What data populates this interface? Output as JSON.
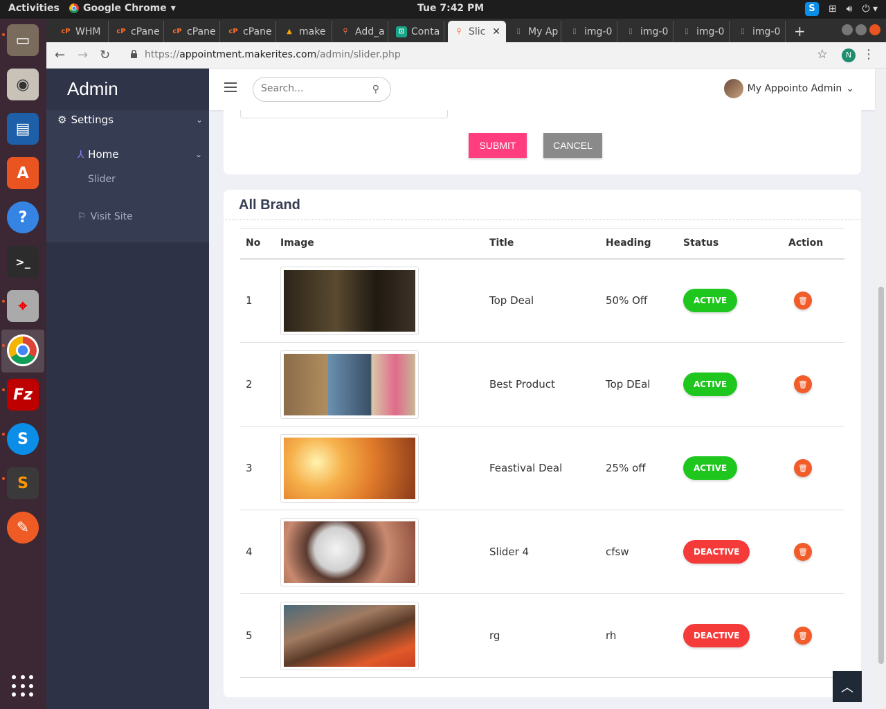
{
  "os": {
    "activities": "Activities",
    "app_name": "Google Chrome",
    "clock": "Tue  7:42 PM",
    "launcher_apps": [
      "files-icon",
      "rhythmbox-icon",
      "writer-icon",
      "software-center-icon",
      "help-icon",
      "terminal-icon",
      "screenshot-icon",
      "chrome-icon",
      "filezilla-icon",
      "skype-icon",
      "sublime-icon",
      "postman-icon"
    ]
  },
  "browser": {
    "tabs": [
      {
        "label": "WHM",
        "icon": "cpanel-icon"
      },
      {
        "label": "cPane",
        "icon": "cpanel-icon"
      },
      {
        "label": "cPane",
        "icon": "cpanel-icon"
      },
      {
        "label": "cPane",
        "icon": "cpanel-icon"
      },
      {
        "label": "make",
        "icon": "maker-icon"
      },
      {
        "label": "Add_a",
        "icon": "pin-icon"
      },
      {
        "label": "Conta",
        "icon": "cart-icon"
      },
      {
        "label": "Slic",
        "icon": "pin-icon"
      },
      {
        "label": "My Ap",
        "icon": "page-icon"
      },
      {
        "label": "img-0",
        "icon": "page-icon"
      },
      {
        "label": "img-0",
        "icon": "page-icon"
      },
      {
        "label": "img-0",
        "icon": "page-icon"
      },
      {
        "label": "img-0",
        "icon": "page-icon"
      }
    ],
    "url_scheme": "https://",
    "url_host": "appointment.makerites.com",
    "url_path": "/admin/slider.php",
    "profile_initial": "N"
  },
  "sidebar": {
    "title": "Admin",
    "settings": "Settings",
    "home": "Home",
    "slider": "Slider",
    "visit_site": "Visit Site"
  },
  "header": {
    "search_placeholder": "Search...",
    "user_name": "My Appointo Admin"
  },
  "form": {
    "submit": "SUBMIT",
    "cancel": "CANCEL"
  },
  "table": {
    "title": "All Brand",
    "columns": [
      "No",
      "Image",
      "Title",
      "Heading",
      "Status",
      "Action"
    ],
    "rows": [
      {
        "no": "1",
        "title": "Top Deal",
        "heading": "50% Off",
        "status": "ACTIVE"
      },
      {
        "no": "2",
        "title": "Best Product",
        "heading": "Top DEal",
        "status": "ACTIVE"
      },
      {
        "no": "3",
        "title": "Feastival Deal",
        "heading": "25% off",
        "status": "ACTIVE"
      },
      {
        "no": "4",
        "title": "Slider 4",
        "heading": "cfsw",
        "status": "DEACTIVE"
      },
      {
        "no": "5",
        "title": "rg",
        "heading": "rh",
        "status": "DEACTIVE"
      }
    ]
  },
  "colors": {
    "active": "#1ec61e",
    "deactive": "#f53a3a",
    "submit": "#ff3d7f",
    "delete": "#f25c2a"
  }
}
